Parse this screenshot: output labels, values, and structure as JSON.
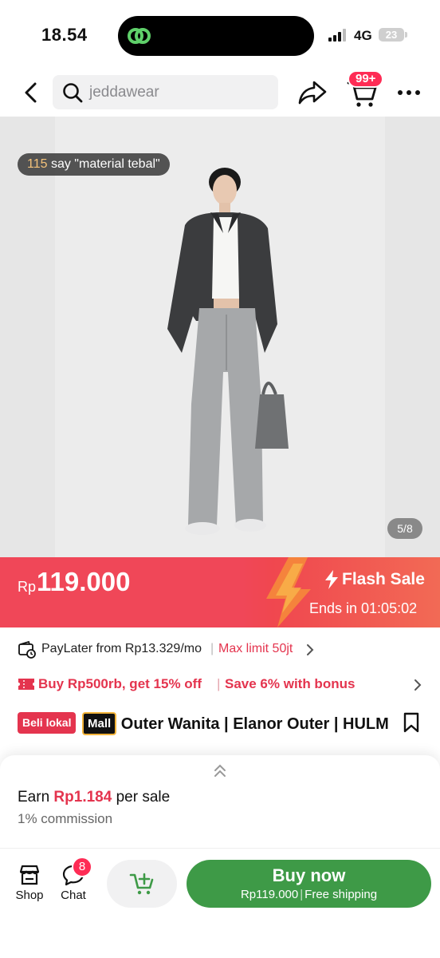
{
  "status_bar": {
    "time": "18.54",
    "network": "4G",
    "battery": "23"
  },
  "nav": {
    "search_text": "jeddawear",
    "cart_badge": "99+"
  },
  "image": {
    "review_count": "115",
    "review_text": " say \"material tebal\"",
    "counter": "5/8"
  },
  "price": {
    "currency": "Rp",
    "amount": "119.000",
    "flash_label": "Flash Sale",
    "ends_text": "Ends in 01:05:02"
  },
  "paylater": {
    "text": "PayLater from Rp13.329/mo",
    "separator": "|",
    "limit": "Max limit 50jt"
  },
  "promo": {
    "text": "Buy Rp500rb, get 15% off",
    "separator": "|",
    "bonus": "Save 6% with bonus"
  },
  "title": {
    "badge_local": "Beli lokal",
    "badge_mall": "Mall",
    "text": "Outer Wanita | Elanor Outer | HULM"
  },
  "affiliate": {
    "earn_prefix": "Earn ",
    "earn_amount": "Rp1.184",
    "earn_suffix": " per sale",
    "commission": "1% commission"
  },
  "bottom": {
    "shop_label": "Shop",
    "chat_label": "Chat",
    "chat_badge": "8",
    "buy_label": "Buy now",
    "buy_price": "Rp119.000",
    "buy_divider": "|",
    "buy_shipping": "Free shipping"
  },
  "colors": {
    "accent": "#fe2c55",
    "price_banner": "#f04758",
    "buy_button": "#3e9a47",
    "promo_text": "#e4344e"
  }
}
